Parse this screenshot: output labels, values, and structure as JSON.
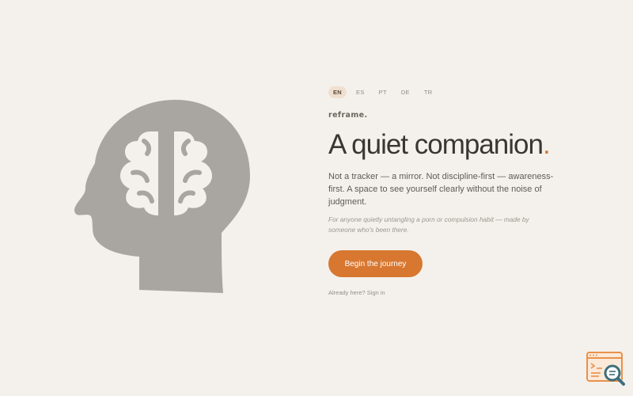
{
  "languages": [
    {
      "code": "EN",
      "active": true
    },
    {
      "code": "ES",
      "active": false
    },
    {
      "code": "PT",
      "active": false
    },
    {
      "code": "DE",
      "active": false
    },
    {
      "code": "TR",
      "active": false
    }
  ],
  "brand": "reframe.",
  "headline": {
    "text": "A quiet companion",
    "accent": "."
  },
  "description": "Not a tracker — a mirror. Not discipline-first — awareness-first. A space to see yourself clearly without the noise of judgment.",
  "note": "For anyone quietly untangling a porn or compulsion habit — made by someone who's been there.",
  "cta": {
    "label": "Begin the journey"
  },
  "signin": {
    "label": "Already here? Sign in"
  },
  "icons": {
    "illustration": "head-brain-icon",
    "corner": "window-search-icon"
  },
  "colors": {
    "background": "#f4f1ec",
    "accent": "#d8772f",
    "illustration": "#a9a6a2",
    "text": "#3b3631"
  }
}
